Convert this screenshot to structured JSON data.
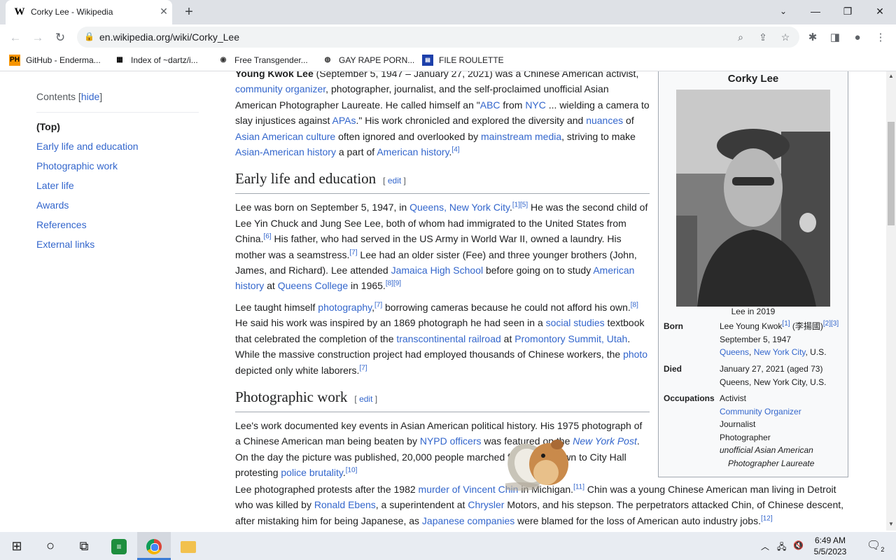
{
  "browser": {
    "tab_title": "Corky Lee - Wikipedia",
    "tab_favicon": "W",
    "url": "en.wikipedia.org/wiki/Corky_Lee",
    "bookmarks": [
      {
        "label": "GitHub - Enderma...",
        "icon": "PH"
      },
      {
        "label": "Index of ~dartz/i...",
        "icon": "grid-icon"
      },
      {
        "label": "Free Transgender...",
        "icon": "circle-icon"
      },
      {
        "label": "GAY RAPE PORN...",
        "icon": "globe-icon"
      },
      {
        "label": "FILE ROULETTE",
        "icon": "file-icon"
      }
    ]
  },
  "toc": {
    "title": "Contents",
    "hide_label": "hide",
    "items": [
      "(Top)",
      "Early life and education",
      "Photographic work",
      "Later life",
      "Awards",
      "References",
      "External links"
    ]
  },
  "article": {
    "intro_bold": "Young Kwok Lee",
    "intro_dates": " (September 5, 1947 – January 27, 2021) was a Chinese American activist, ",
    "intro": {
      "l1": "community organizer",
      "t1": ", photographer, journalist, and the self-proclaimed unofficial Asian American Photographer Laureate. He called himself an \"",
      "l2": "ABC",
      "t2": " from ",
      "l3": "NYC",
      "t3": " ... wielding a camera to slay injustices against ",
      "l4": "APAs",
      "t4": ".\" His work chronicled and explored the diversity and ",
      "l5": "nuances",
      "t5": " of ",
      "l6": "Asian American culture",
      "t6": " often ignored and overlooked by ",
      "l7": "mainstream media",
      "t7": ", striving to make ",
      "l8": "Asian-American history",
      "t8": " a part of ",
      "l9": "American history",
      "t9": ".",
      "r1": "[4]"
    },
    "h_early": "Early life and education",
    "edit_label": "edit",
    "early1": {
      "t1": "Lee was born on September 5, 1947, in ",
      "l1": "Queens, New York City",
      "t2": ".",
      "r1": "[1][5]",
      "t3": " He was the second child of Lee Yin Chuck and Jung See Lee, both of whom had immigrated to the United States from China.",
      "r2": "[6]",
      "t4": " His father, who had served in the US Army in World War II, owned a laundry. His mother was a seamstress.",
      "r3": "[7]",
      "t5": " Lee had an older sister (Fee) and three younger brothers (John, James, and Richard). Lee attended ",
      "l2": "Jamaica High School",
      "t6": " before going on to study ",
      "l3": "American history",
      "t7": " at ",
      "l4": "Queens College",
      "t8": " in 1965.",
      "r4": "[8][9]"
    },
    "early2": {
      "t1": "Lee taught himself ",
      "l1": "photography",
      "t2": ",",
      "r1": "[7]",
      "t3": " borrowing cameras because he could not afford his own.",
      "r2": "[8]",
      "t4": " He said his work was inspired by an 1869 photograph he had seen in a ",
      "l2": "social studies",
      "t5": " textbook that celebrated the completion of the ",
      "l3": "transcontinental railroad",
      "t6": " at ",
      "l4": "Promontory Summit, Utah",
      "t7": ". While the massive construction project had employed thousands of Chinese workers, the ",
      "l5": "photo",
      "t8": " depicted only white laborers.",
      "r3": "[7]"
    },
    "h_photo": "Photographic work",
    "photo1": {
      "t1": "Lee's work documented key events in Asian American political history. His 1975 photograph of a Chinese American man being beaten by ",
      "l1": "NYPD officers",
      "t2": " was featured on the ",
      "l2": "New York Post",
      "t3": ". On the day the picture was published, 20,000 people marched from Chinatown to City Hall protesting ",
      "l3": "police brutality",
      "t4": ".",
      "r1": "[10]"
    },
    "photo2": {
      "t1": "Lee photographed protests after the 1982 ",
      "l1": "murder of Vincent Chin",
      "t2": " in Michigan.",
      "r1": "[11]",
      "t3": " Chin was a young Chinese American man living in Detroit who was killed by ",
      "l2": "Ronald Ebens",
      "t4": ", a superintendent at ",
      "l3": "Chrysler",
      "t5": " Motors, and his stepson. The perpetrators attacked Chin, of Chinese descent, after mistaking him for being Japanese, as ",
      "l4": "Japanese companies",
      "t6": " were blamed for the loss of American auto industry jobs.",
      "r2": "[12]"
    }
  },
  "infobox": {
    "title": "Corky Lee",
    "caption": "Lee in 2019",
    "born_label": "Born",
    "born_name": "Lee Young Kwok",
    "born_name_ref": "[1]",
    "born_chinese": " (李揚國)",
    "born_chinese_ref": "[2][3]",
    "born_date": "September 5, 1947",
    "born_place_l1": "Queens",
    "born_place_sep": ", ",
    "born_place_l2": "New York City",
    "born_place_t": ", U.S.",
    "died_label": "Died",
    "died_date": "January 27, 2021 (aged 73)",
    "died_place": "Queens, New York City, U.S.",
    "occ_label": "Occupations",
    "occ1": "Activist",
    "occ2": "Community Organizer",
    "occ3": "Journalist",
    "occ4": "Photographer",
    "occ5": "unofficial Asian American Photographer Laureate"
  },
  "taskbar": {
    "time": "6:49 AM",
    "date": "5/5/2023",
    "notification_count": "2"
  }
}
